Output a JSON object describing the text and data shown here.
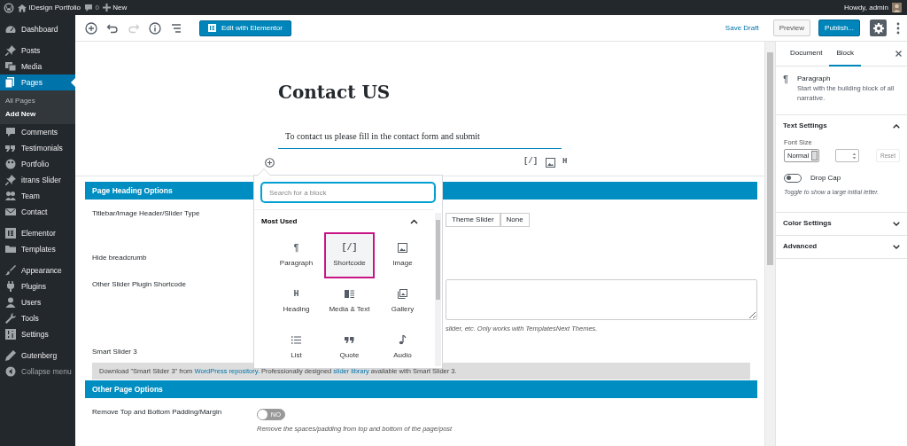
{
  "admin_bar": {
    "site": "IDesign Portfolio",
    "comments": "0",
    "new": "New",
    "greeting": "Howdy, admin"
  },
  "sidebar": {
    "groups": [
      [
        {
          "label": "Dashboard",
          "kind": "menu",
          "selected": false
        }
      ],
      [
        {
          "label": "Posts",
          "kind": "menu",
          "selected": false
        },
        {
          "label": "Media",
          "kind": "menu",
          "selected": false
        },
        {
          "label": "Pages",
          "kind": "menu",
          "selected": true,
          "children": [
            {
              "label": "All Pages",
              "selected": false
            },
            {
              "label": "Add New",
              "selected": true
            }
          ]
        },
        {
          "label": "Comments",
          "kind": "menu",
          "selected": false
        },
        {
          "label": "Testimonials",
          "kind": "menu",
          "selected": false
        },
        {
          "label": "Portfolio",
          "kind": "menu",
          "selected": false
        },
        {
          "label": "itrans Slider",
          "kind": "menu",
          "selected": false
        },
        {
          "label": "Team",
          "kind": "menu",
          "selected": false
        },
        {
          "label": "Contact",
          "kind": "menu",
          "selected": false
        }
      ],
      [
        {
          "label": "Elementor",
          "kind": "menu",
          "selected": false
        },
        {
          "label": "Templates",
          "kind": "menu",
          "selected": false
        }
      ],
      [
        {
          "label": "Appearance",
          "kind": "menu",
          "selected": false
        },
        {
          "label": "Plugins",
          "kind": "menu",
          "selected": false
        },
        {
          "label": "Users",
          "kind": "menu",
          "selected": false
        },
        {
          "label": "Tools",
          "kind": "menu",
          "selected": false
        },
        {
          "label": "Settings",
          "kind": "menu",
          "selected": false
        }
      ],
      [
        {
          "label": "Gutenberg",
          "kind": "menu",
          "selected": false
        },
        {
          "label": "Collapse menu",
          "kind": "collapse",
          "selected": false
        }
      ]
    ]
  },
  "toolbar": {
    "undo_disabled": false,
    "redo_disabled": true,
    "elementor_button": "Edit with Elementor",
    "save_draft": "Save Draft",
    "preview": "Preview",
    "publish": "Publish...",
    "settings_open": true
  },
  "post": {
    "title": "Contact US",
    "paragraph": "To contact us please fill in the contact form and submit",
    "block_toolbar": [
      {
        "kind": "glyph",
        "glyph": "[/]"
      },
      {
        "kind": "image"
      },
      {
        "kind": "glyph",
        "glyph": "H"
      }
    ]
  },
  "inserter": {
    "placeholder": "Search for a block",
    "section": "Most Used",
    "expanded": true,
    "blocks": [
      {
        "label": "Paragraph",
        "kind": "glyph",
        "glyph": "¶",
        "selected": false
      },
      {
        "label": "Shortcode",
        "kind": "glyph",
        "glyph": "[/]",
        "selected": true
      },
      {
        "label": "Image",
        "kind": "image",
        "selected": false
      },
      {
        "label": "Heading",
        "kind": "glyph",
        "glyph": "H",
        "selected": false
      },
      {
        "label": "Media & Text",
        "kind": "media-text",
        "selected": false
      },
      {
        "label": "Gallery",
        "kind": "gallery",
        "selected": false
      },
      {
        "label": "List",
        "kind": "list",
        "selected": false
      },
      {
        "label": "Quote",
        "kind": "quote",
        "selected": false
      },
      {
        "label": "Audio",
        "kind": "audio",
        "selected": false
      }
    ]
  },
  "meta_boxes": [
    {
      "title": "Page Heading Options",
      "fields": [
        {
          "kind": "buttons",
          "label": "Titlebar/Image Header/Slider Type",
          "options": [
            {
              "label": "Theme Slider",
              "selected": false
            },
            {
              "label": "None",
              "selected": false
            }
          ]
        },
        {
          "kind": "empty",
          "label": "Hide breadcrumb"
        },
        {
          "kind": "textarea",
          "label": "Other Slider Plugin Shortcode",
          "hint": "slider, etc. Only works with TemplatesNext Themes."
        },
        {
          "kind": "notice",
          "label": "Smart Slider 3",
          "notice": [
            {
              "text": "Download \"Smart Slider 3\" from ",
              "link": false
            },
            {
              "text": "WordPress repository",
              "link": true
            },
            {
              "text": ". Professionally designed ",
              "link": false
            },
            {
              "text": "slider library",
              "link": true
            },
            {
              "text": " available with Smart Slider 3.",
              "link": false
            }
          ]
        }
      ]
    },
    {
      "title": "Other Page Options",
      "fields": [
        {
          "kind": "toggle",
          "label": "Remove Top and Bottom Padding/Margin",
          "on": false,
          "toggle_text": "NO",
          "hint": "Remove the spaces/padding from top and bottom of the page/post"
        }
      ]
    }
  ],
  "settings_panel": {
    "tabs": [
      {
        "label": "Document",
        "selected": false
      },
      {
        "label": "Block",
        "selected": true
      }
    ],
    "block_name": "Paragraph",
    "block_description": "Start with the building block of all narrative.",
    "sections": [
      {
        "title": "Text Settings",
        "expanded": true,
        "body": {
          "font_size_label": "Font Size",
          "font_size": "Normal",
          "reset": "Reset",
          "reset_disabled": true,
          "drop_cap_label": "Drop Cap",
          "drop_cap": false,
          "drop_cap_hint": "Toggle to show a large initial letter."
        }
      },
      {
        "title": "Color Settings",
        "expanded": false
      },
      {
        "title": "Advanced",
        "expanded": false
      }
    ]
  }
}
